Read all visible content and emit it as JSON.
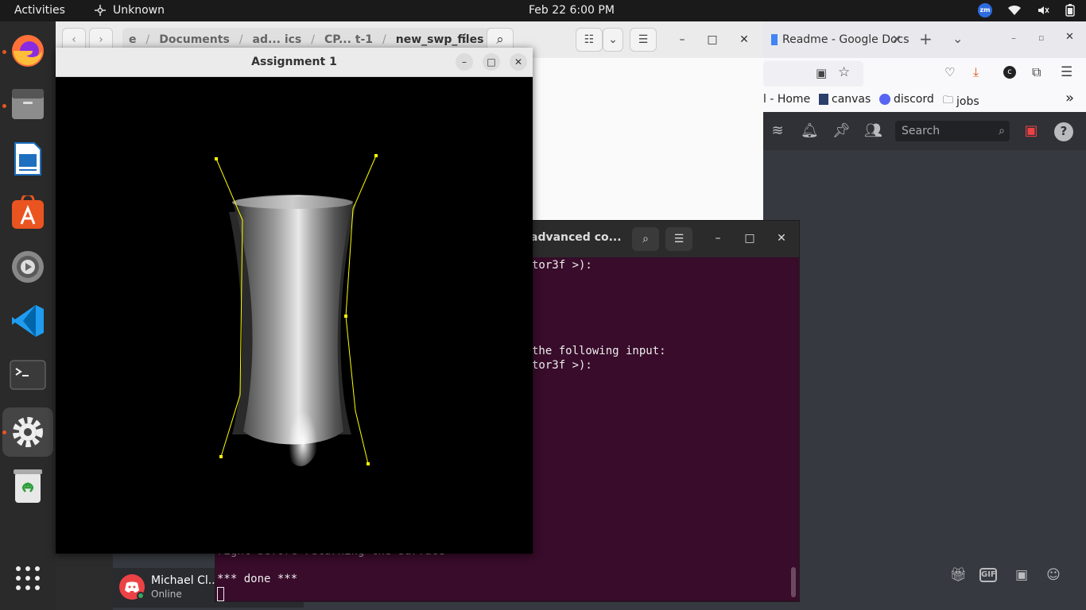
{
  "topbar": {
    "activities": "Activities",
    "app_name": "Unknown",
    "datetime": "Feb 22  6:00 PM",
    "zoom_badge": "zm"
  },
  "dock": {
    "items": [
      "firefox-icon",
      "files-icon",
      "writer-icon",
      "app-center-icon",
      "settings-icon",
      "vscode-icon",
      "terminal-icon",
      "settings-active-icon",
      "trash-icon",
      "app-grid-icon"
    ]
  },
  "files_window": {
    "back": "‹",
    "forward": "›",
    "path_segments": [
      "e",
      "Documents",
      "ad... ics",
      "CP... t-1",
      "new_swp_files"
    ],
    "path_separator": "/",
    "menu": "⋮",
    "search": "⌕",
    "view_list": "☷",
    "view_dropdown": "⌄",
    "hamburger": "☰",
    "minimize": "–",
    "maximize": "□",
    "close": "✕"
  },
  "browser": {
    "tab_title": "Readme - Google Docs",
    "tab_close": "✕",
    "new_tab": "+",
    "tab_list": "⌄",
    "bookmarks": [
      "l - Home",
      "canvas",
      "discord",
      "jobs"
    ],
    "bookmarks_more": "»",
    "discord_search_placeholder": "Search",
    "help": "?"
  },
  "discord_user": {
    "name": "Michael Cl...",
    "status": "Online",
    "gif_label": "GIF"
  },
  "terminal": {
    "title": "advanced co...",
    "lines": [
      "tor3f >):",
      "the following input:",
      "tor3f >):",
      "right before returning the surface",
      "*** done ***"
    ]
  },
  "assignment_window": {
    "title": "Assignment 1",
    "minimize": "–",
    "maximize": "□",
    "close": "✕"
  }
}
